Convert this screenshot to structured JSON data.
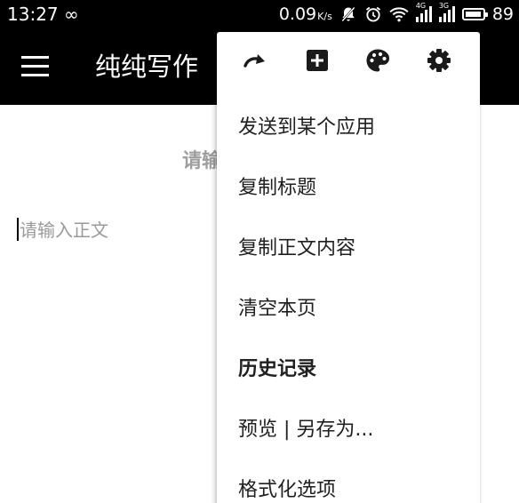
{
  "status_bar": {
    "time": "13:27",
    "link_icon": "∞",
    "net_speed": "0.09",
    "net_unit": "K/s",
    "signal1_label": "4G",
    "signal2_label": "3G",
    "battery_level": "89"
  },
  "app_bar": {
    "menu_icon": "hamburger-menu-icon",
    "title": "纯纯写作"
  },
  "editor": {
    "title_placeholder": "请输",
    "body_placeholder": "请输入正文"
  },
  "menu": {
    "icons": [
      "redo-icon",
      "add-box-icon",
      "palette-icon",
      "settings-icon"
    ],
    "items": [
      {
        "label": "发送到某个应用",
        "bold": false
      },
      {
        "label": "复制标题",
        "bold": false
      },
      {
        "label": "复制正文内容",
        "bold": false
      },
      {
        "label": "清空本页",
        "bold": false
      },
      {
        "label": "历史记录",
        "bold": true
      },
      {
        "label": "预览 | 另存为...",
        "bold": false
      },
      {
        "label": "格式化选项",
        "bold": false
      }
    ]
  }
}
